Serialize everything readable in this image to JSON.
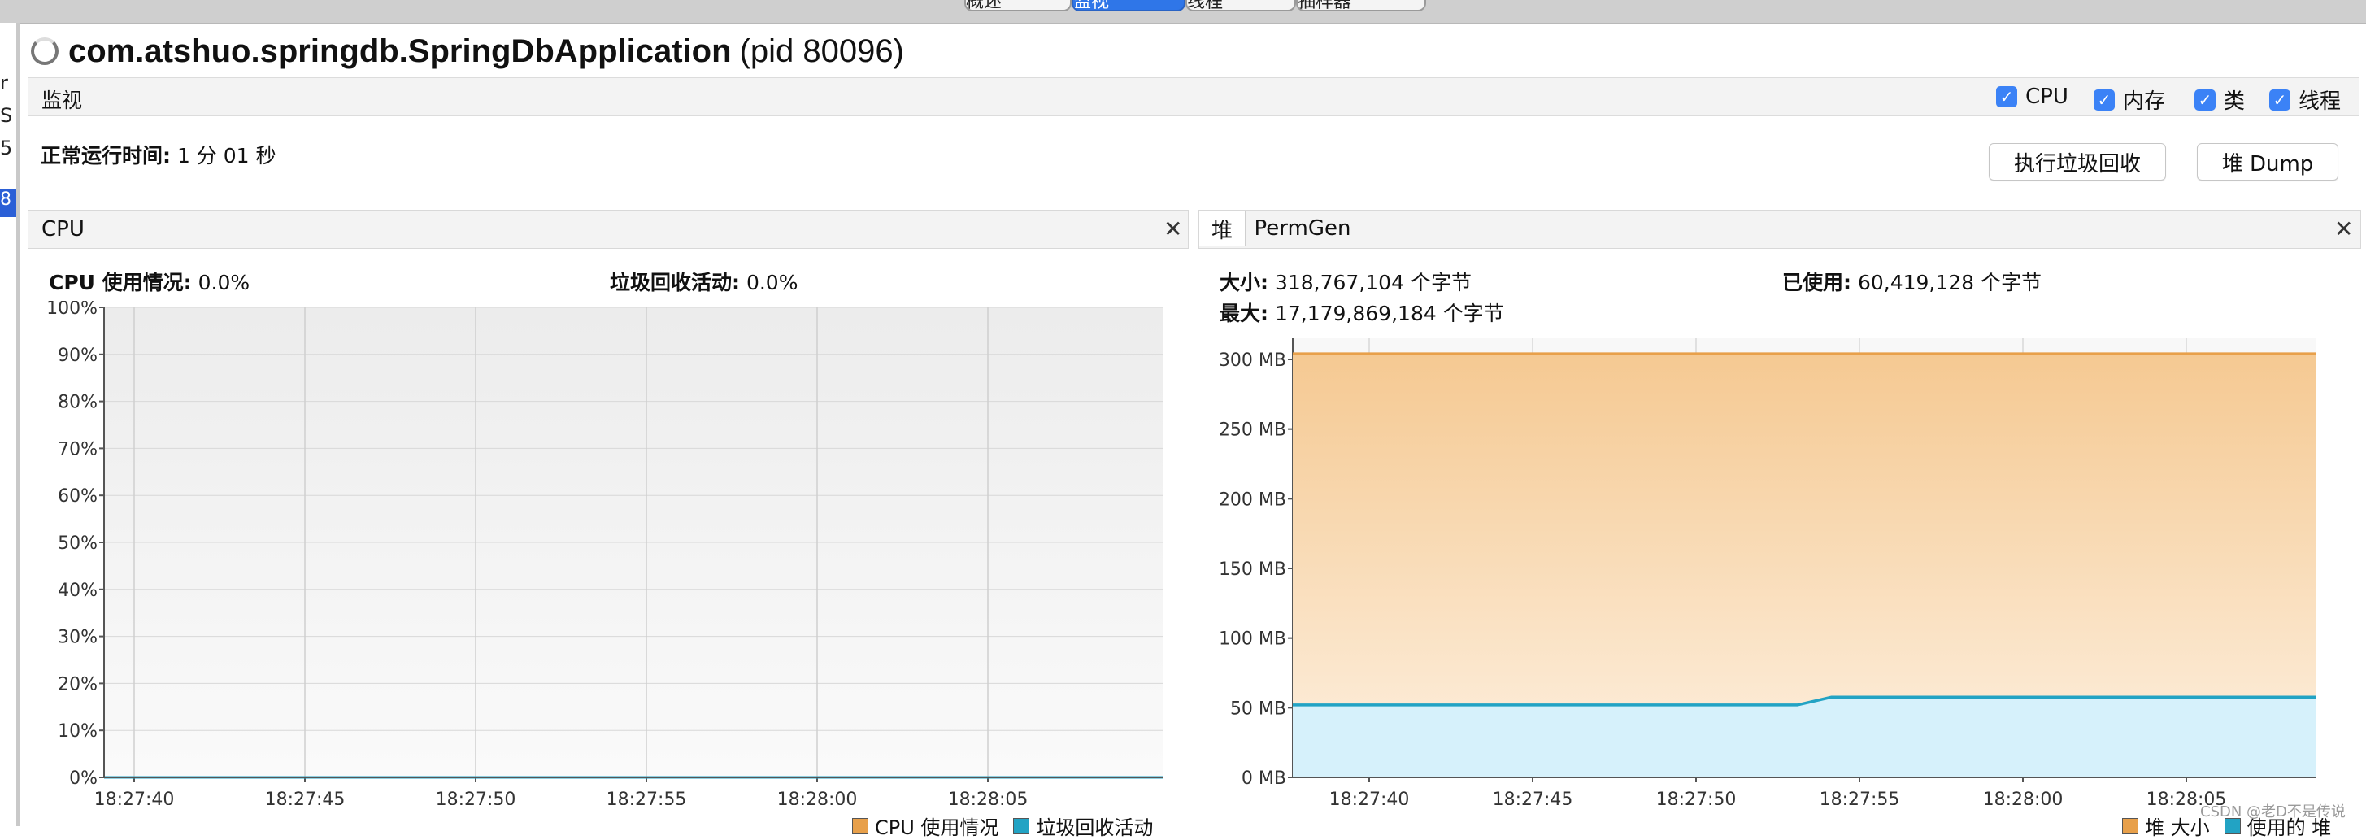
{
  "top_tabs": [
    "概述",
    "监视",
    "线程",
    "抽样器"
  ],
  "gutter_fragments": [
    "r",
    "S",
    "5)",
    "8"
  ],
  "app": {
    "name": "com.atshuo.springdb.SpringDbApplication",
    "pid": "(pid 80096)"
  },
  "monitor": {
    "label": "监视",
    "checkboxes": [
      {
        "label": "CPU",
        "checked": true
      },
      {
        "label": "内存",
        "checked": true
      },
      {
        "label": "类",
        "checked": true
      },
      {
        "label": "线程",
        "checked": true
      }
    ]
  },
  "uptime": {
    "label": "正常运行时间:",
    "value": "1 分 01 秒"
  },
  "buttons": {
    "gc": "执行垃圾回收",
    "heap_dump": "堆 Dump"
  },
  "cpu_panel": {
    "title": "CPU",
    "usage_label": "CPU 使用情况:",
    "usage_value": "0.0%",
    "gc_label": "垃圾回收活动:",
    "gc_value": "0.0%",
    "legend": [
      "CPU 使用情况",
      "垃圾回收活动"
    ]
  },
  "heap_panel": {
    "tabs": [
      "堆",
      "PermGen"
    ],
    "size_label": "大小:",
    "size_value": "318,767,104 个字节",
    "max_label": "最大:",
    "max_value": "17,179,869,184 个字节",
    "used_label": "已使用:",
    "used_value": "60,419,128 个字节",
    "legend": [
      "堆 大小",
      "使用的 堆"
    ]
  },
  "colors": {
    "accent": "#3b82f6",
    "heap_size_line": "#e8a04a",
    "heap_used_line": "#22a3c4",
    "heap_size_fill": "#f7cfa0",
    "heap_used_fill": "#d6f1fb"
  },
  "chart_data": [
    {
      "type": "line",
      "ylim": [
        0,
        100
      ],
      "yticks": [
        "0%",
        "10%",
        "20%",
        "30%",
        "40%",
        "50%",
        "60%",
        "70%",
        "80%",
        "90%",
        "100%"
      ],
      "x": [
        "18:27:40",
        "18:27:45",
        "18:27:50",
        "18:27:55",
        "18:28:00",
        "18:28:05"
      ],
      "series": [
        {
          "name": "CPU 使用情况",
          "values": [
            0,
            0,
            0,
            0,
            0,
            0
          ]
        },
        {
          "name": "垃圾回收活动",
          "values": [
            0,
            0,
            0,
            0,
            0,
            0
          ]
        }
      ],
      "grid": true,
      "legend": "bottom-right"
    },
    {
      "type": "area",
      "ylim": [
        0,
        300
      ],
      "yticks": [
        "0 MB",
        "50 MB",
        "100 MB",
        "150 MB",
        "200 MB",
        "250 MB",
        "300 MB"
      ],
      "x": [
        "18:27:40",
        "18:27:45",
        "18:27:50",
        "18:27:55",
        "18:28:00",
        "18:28:05"
      ],
      "series": [
        {
          "name": "堆 大小",
          "points": [
            [
              0,
              304
            ],
            [
              30,
              304
            ]
          ]
        },
        {
          "name": "使用的 堆",
          "points": [
            [
              0,
              52
            ],
            [
              14.8,
              52
            ],
            [
              15.8,
              57.6
            ],
            [
              30,
              57.6
            ]
          ]
        }
      ],
      "grid": true,
      "legend": "bottom-right"
    }
  ],
  "watermark": "CSDN @老D不是传说"
}
